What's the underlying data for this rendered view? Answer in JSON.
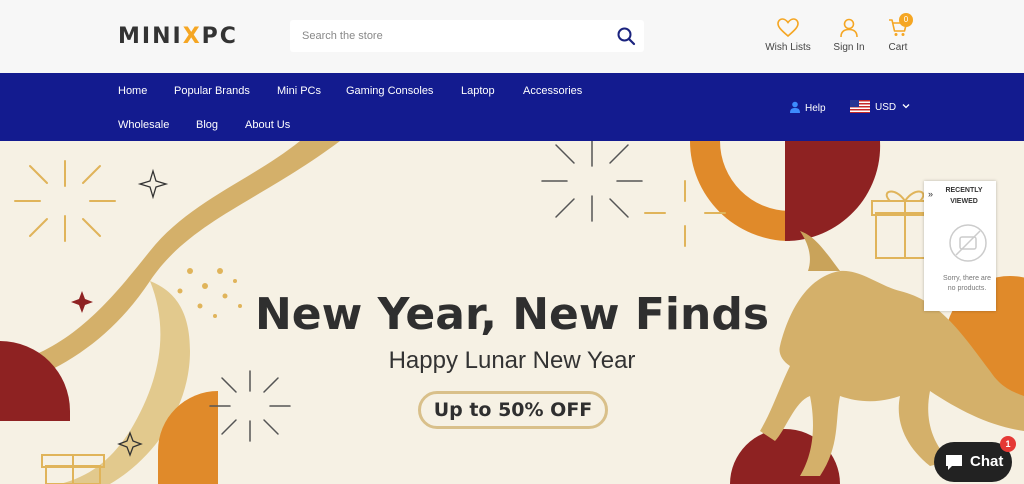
{
  "header": {
    "logo": {
      "part1": "MINI",
      "part2": "X",
      "part3": "PC"
    },
    "search": {
      "placeholder": "Search the store"
    },
    "wishlist_label": "Wish Lists",
    "signin_label": "Sign In",
    "cart_label": "Cart",
    "cart_count": "0"
  },
  "nav": {
    "items": [
      {
        "label": "Home"
      },
      {
        "label": "Popular Brands"
      },
      {
        "label": "Mini PCs"
      },
      {
        "label": "Gaming Consoles"
      },
      {
        "label": "Laptop"
      },
      {
        "label": "Accessories"
      },
      {
        "label": "Wholesale"
      },
      {
        "label": "Blog"
      },
      {
        "label": "About Us"
      }
    ],
    "help_label": "Help",
    "currency": "USD"
  },
  "banner": {
    "headline": "New Year, New Finds",
    "subline": "Happy Lunar New Year",
    "offer": "Up to 50% OFF"
  },
  "recently_viewed": {
    "title": "RECENTLY VIEWED",
    "empty_message": "Sorry, there are no products."
  },
  "chat": {
    "label": "Chat",
    "badge": "1"
  },
  "colors": {
    "nav_bg": "#131b8f",
    "accent": "#f5a623",
    "banner_bg": "#f6f1e4",
    "gold": "#d4b06a",
    "red": "#8e2222",
    "orange": "#e08a2a"
  }
}
